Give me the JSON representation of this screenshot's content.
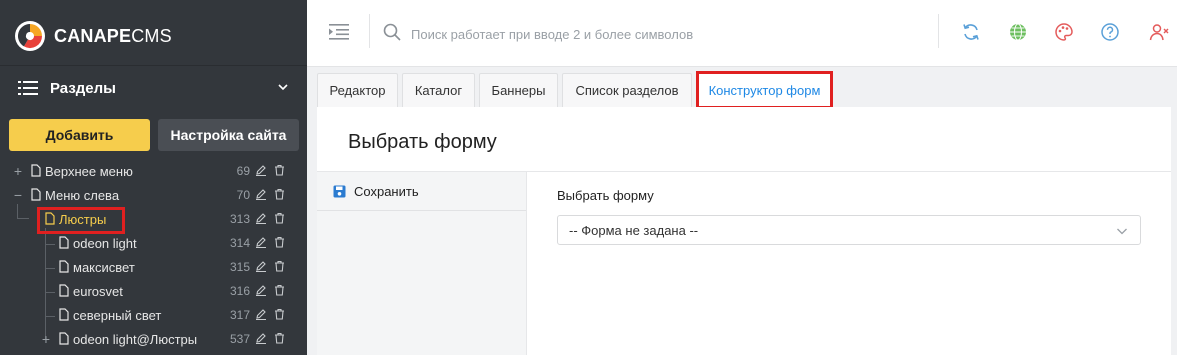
{
  "brand": {
    "name_bold": "CANAPE",
    "name_light": "CMS"
  },
  "sidebar": {
    "section_title": "Разделы",
    "add_button": "Добавить",
    "settings_button": "Настройка сайта",
    "tree": [
      {
        "label": "Верхнее меню",
        "id": "69",
        "expanded": false
      },
      {
        "label": "Меню слева",
        "id": "70",
        "expanded": true
      },
      {
        "label": "Люстры",
        "id": "313",
        "expanded": true,
        "selected": true
      },
      {
        "label": "odeon light",
        "id": "314"
      },
      {
        "label": "максисвет",
        "id": "315"
      },
      {
        "label": "eurosvet",
        "id": "316"
      },
      {
        "label": "северный свет",
        "id": "317"
      },
      {
        "label": "odeon light@Люстры",
        "id": "537",
        "expanded": false
      }
    ]
  },
  "topbar": {
    "search_placeholder": "Поиск работает при вводе 2 и более символов",
    "icons": [
      "refresh-icon",
      "globe-icon",
      "palette-icon",
      "help-icon",
      "user-icon"
    ]
  },
  "tabs": [
    {
      "label": "Редактор"
    },
    {
      "label": "Каталог"
    },
    {
      "label": "Баннеры"
    },
    {
      "label": "Список разделов"
    },
    {
      "label": "Конструктор форм",
      "active": true
    }
  ],
  "panel": {
    "title": "Выбрать форму",
    "save_label": "Сохранить",
    "field_label": "Выбрать форму",
    "select_value": "-- Форма не задана --"
  },
  "colors": {
    "sidebar_bg": "#33373c",
    "accent_yellow": "#f6cd4c",
    "active_tab": "#1e88e5",
    "highlight": "#e02020"
  }
}
